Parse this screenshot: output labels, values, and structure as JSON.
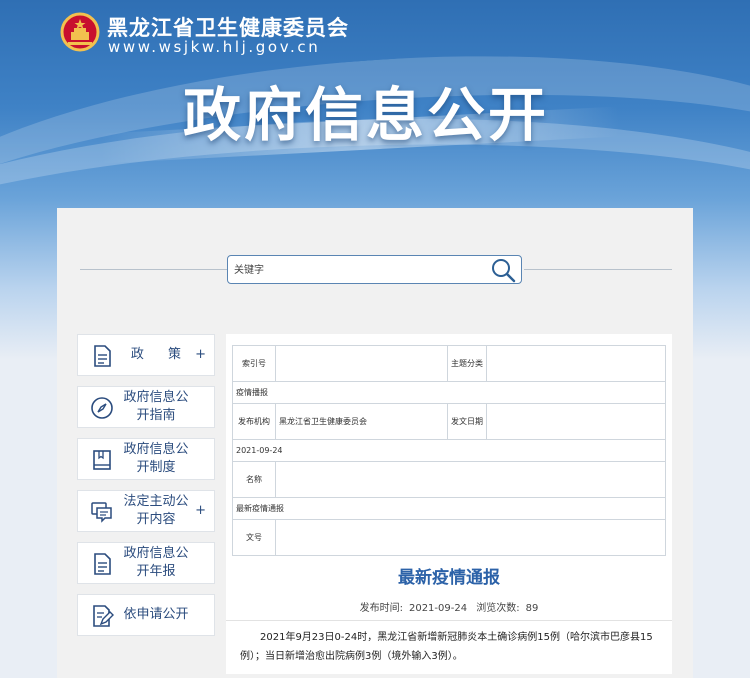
{
  "header": {
    "site_name": "黑龙江省卫生健康委员会",
    "site_url": "www.wsjkw.hlj.gov.cn",
    "banner_title": "政府信息公开"
  },
  "search": {
    "placeholder": "关键字"
  },
  "sidebar": {
    "items": [
      {
        "label": "政 策",
        "plus": "+",
        "icon": "document-icon"
      },
      {
        "label": "政府信息公开指南",
        "plus": "",
        "icon": "compass-icon"
      },
      {
        "label": "政府信息公开制度",
        "plus": "",
        "icon": "book-icon"
      },
      {
        "label": "法定主动公开内容",
        "plus": "+",
        "icon": "chat-icon"
      },
      {
        "label": "政府信息公开年报",
        "plus": "",
        "icon": "report-icon"
      },
      {
        "label": "依申请公开",
        "plus": "",
        "icon": "edit-form-icon"
      }
    ]
  },
  "meta_table": {
    "index_label": "索引号",
    "index_value": "",
    "category_label": "主题分类",
    "category_value": "疫情播报",
    "publisher_label": "发布机构",
    "publisher_value": "黑龙江省卫生健康委员会",
    "issue_date_label": "发文日期",
    "issue_date_value": "2021-09-24",
    "name_label": "名称",
    "name_value": "最新疫情通报",
    "doc_no_label": "文号",
    "doc_no_value": ""
  },
  "article": {
    "title": "最新疫情通报",
    "publish_time_label": "发布时间:",
    "publish_time": "2021-09-24",
    "views_label": "浏览次数:",
    "views": "89",
    "body": "2021年9月23日0-24时，黑龙江省新增新冠肺炎本土确诊病例15例（哈尔滨市巴彦县15例）；当日新增治愈出院病例3例（境外输入3例）。"
  },
  "colors": {
    "brand_blue": "#2f6fb4",
    "title_blue": "#2c62a8",
    "nav_text": "#2b4c7e"
  }
}
